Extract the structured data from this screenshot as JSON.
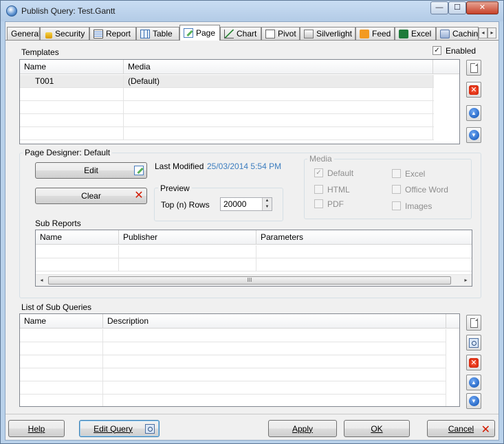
{
  "window": {
    "title": "Publish Query: Test.Gantt",
    "minimize_glyph": "—",
    "maximize_glyph": "☐",
    "close_glyph": "✕"
  },
  "tabs": [
    {
      "label": "General",
      "icon": "none"
    },
    {
      "label": "Security",
      "icon": "lock-icon"
    },
    {
      "label": "Report",
      "icon": "report-icon"
    },
    {
      "label": "Table",
      "icon": "table-icon"
    },
    {
      "label": "Page",
      "icon": "page-edit-icon",
      "active": true
    },
    {
      "label": "Chart",
      "icon": "chart-icon"
    },
    {
      "label": "Pivot",
      "icon": "pivot-icon"
    },
    {
      "label": "Silverlight",
      "icon": "silverlight-icon"
    },
    {
      "label": "Feed",
      "icon": "feed-icon"
    },
    {
      "label": "Excel",
      "icon": "excel-icon"
    },
    {
      "label": "Cachin",
      "icon": "cache-icon"
    }
  ],
  "tab_scroll": {
    "left": "◂",
    "right": "▸"
  },
  "templates": {
    "title": "Templates",
    "enabled_label": "Enabled",
    "enabled_check": "✓",
    "columns": [
      "Name",
      "Media"
    ],
    "rows": [
      {
        "name": "T001",
        "media": "(Default)"
      }
    ]
  },
  "designer": {
    "title": "Page Designer: Default",
    "edit_label": "Edit",
    "clear_label": "Clear",
    "last_modified_label": "Last Modified",
    "last_modified_value": "25/03/2014 5:54 PM",
    "preview_title": "Preview",
    "top_rows_label": "Top (n) Rows",
    "top_rows_value": "20000",
    "media": {
      "title": "Media",
      "default": "Default",
      "html": "HTML",
      "pdf": "PDF",
      "excel": "Excel",
      "office_word": "Office Word",
      "images": "Images",
      "check": "✓"
    },
    "sub_reports": {
      "title": "Sub Reports",
      "columns": [
        "Name",
        "Publisher",
        "Parameters"
      ],
      "scroll_left": "◂",
      "scroll_right": "▸",
      "scroll_grip": "III"
    }
  },
  "sub_queries": {
    "title": "List of Sub Queries",
    "columns": [
      "Name",
      "Description"
    ]
  },
  "side_icons": {
    "delete": "✕",
    "up": "▲",
    "down": "▼"
  },
  "spin": {
    "up": "▲",
    "down": "▼"
  },
  "footer": {
    "help": "Help",
    "edit_query": "Edit Query",
    "apply": "Apply",
    "ok": "OK",
    "cancel": "Cancel"
  }
}
